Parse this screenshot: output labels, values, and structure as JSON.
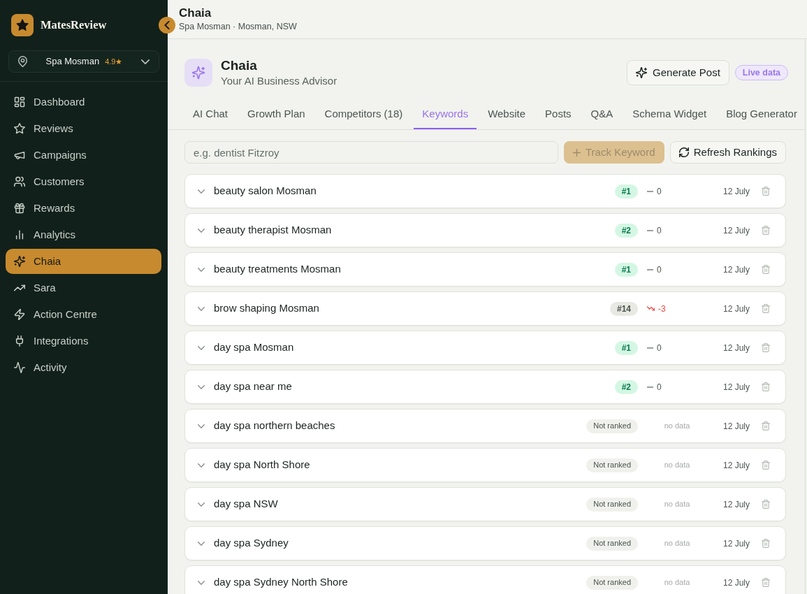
{
  "sidebar": {
    "brand": "MatesReview",
    "location": {
      "name": "Spa Mosman",
      "rating": "4.9★"
    },
    "items": [
      {
        "label": "Dashboard",
        "selected": false
      },
      {
        "label": "Reviews",
        "selected": false
      },
      {
        "label": "Campaigns",
        "selected": false
      },
      {
        "label": "Customers",
        "selected": false
      },
      {
        "label": "Rewards",
        "selected": false
      },
      {
        "label": "Analytics",
        "selected": false
      },
      {
        "label": "Chaia",
        "selected": true
      },
      {
        "label": "Sara",
        "selected": false
      },
      {
        "label": "Action Centre",
        "selected": false
      },
      {
        "label": "Integrations",
        "selected": false
      },
      {
        "label": "Activity",
        "selected": false
      }
    ]
  },
  "header": {
    "title": "Chaia",
    "subtitle": "Spa Mosman · Mosman, NSW"
  },
  "advisor": {
    "title": "Chaia",
    "subtitle": "Your AI Business Advisor",
    "action": "Generate Post",
    "badge": "Live data"
  },
  "tabs": [
    {
      "label": "AI Chat",
      "selected": false
    },
    {
      "label": "Growth Plan",
      "selected": false
    },
    {
      "label": "Competitors (18)",
      "selected": false
    },
    {
      "label": "Keywords",
      "selected": true
    },
    {
      "label": "Website",
      "selected": false
    },
    {
      "label": "Posts",
      "selected": false
    },
    {
      "label": "Q&A",
      "selected": false
    },
    {
      "label": "Schema Widget",
      "selected": false
    },
    {
      "label": "Blog Generator",
      "selected": false
    }
  ],
  "keyword_form": {
    "placeholder": "e.g. dentist Fitzroy",
    "add_button": {
      "label": "Track Keyword",
      "disabled": true
    },
    "refresh_button": "Refresh Rankings"
  },
  "keywords": [
    {
      "keyword": "beauty salon Mosman",
      "rank": {
        "kind": "top",
        "text": "#1"
      },
      "change": {
        "kind": "flat",
        "text": "0"
      },
      "date": "12 July"
    },
    {
      "keyword": "beauty therapist Mosman",
      "rank": {
        "kind": "top",
        "text": "#2"
      },
      "change": {
        "kind": "flat",
        "text": "0"
      },
      "date": "12 July"
    },
    {
      "keyword": "beauty treatments Mosman",
      "rank": {
        "kind": "top",
        "text": "#1"
      },
      "change": {
        "kind": "flat",
        "text": "0"
      },
      "date": "12 July"
    },
    {
      "keyword": "brow shaping Mosman",
      "rank": {
        "kind": "ranked",
        "text": "#14"
      },
      "change": {
        "kind": "down",
        "text": "-3"
      },
      "date": "12 July"
    },
    {
      "keyword": "day spa Mosman",
      "rank": {
        "kind": "top",
        "text": "#1"
      },
      "change": {
        "kind": "flat",
        "text": "0"
      },
      "date": "12 July"
    },
    {
      "keyword": "day spa near me",
      "rank": {
        "kind": "top",
        "text": "#2"
      },
      "change": {
        "kind": "flat",
        "text": "0"
      },
      "date": "12 July"
    },
    {
      "keyword": "day spa northern beaches",
      "rank": {
        "kind": "none",
        "text": "Not ranked"
      },
      "change": {
        "kind": "none",
        "text": "no data"
      },
      "date": "12 July"
    },
    {
      "keyword": "day spa North Shore",
      "rank": {
        "kind": "none",
        "text": "Not ranked"
      },
      "change": {
        "kind": "none",
        "text": "no data"
      },
      "date": "12 July"
    },
    {
      "keyword": "day spa NSW",
      "rank": {
        "kind": "none",
        "text": "Not ranked"
      },
      "change": {
        "kind": "none",
        "text": "no data"
      },
      "date": "12 July"
    },
    {
      "keyword": "day spa Sydney",
      "rank": {
        "kind": "none",
        "text": "Not ranked"
      },
      "change": {
        "kind": "none",
        "text": "no data"
      },
      "date": "12 July"
    },
    {
      "keyword": "day spa Sydney North Shore",
      "rank": {
        "kind": "none",
        "text": "Not ranked"
      },
      "change": {
        "kind": "none",
        "text": "no data"
      },
      "date": "12 July"
    }
  ]
}
